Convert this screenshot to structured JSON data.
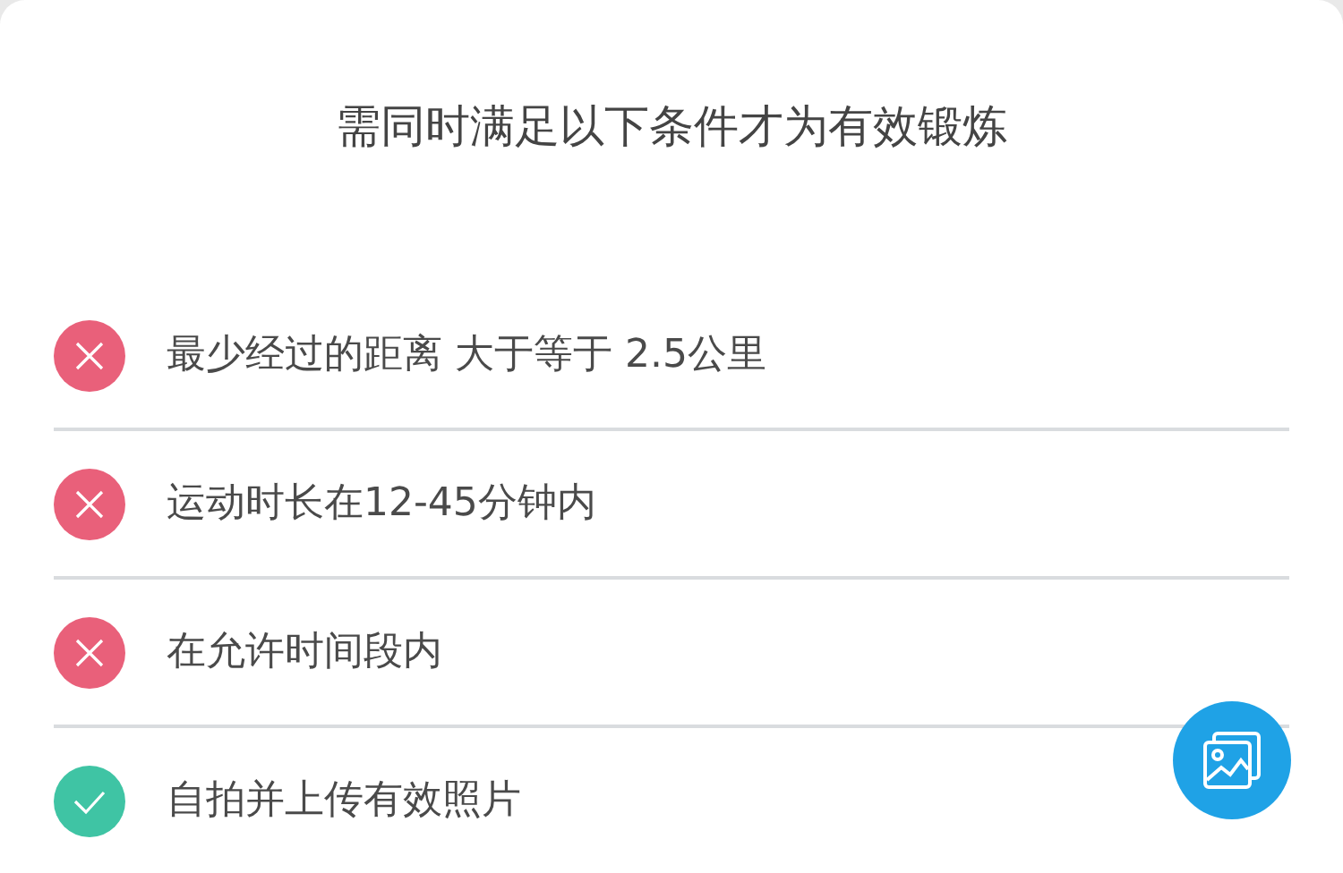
{
  "dialog": {
    "title": "需同时满足以下条件才为有效锻炼"
  },
  "conditions": [
    {
      "text": "最少经过的距离 大于等于 2.5公里",
      "checked": false
    },
    {
      "text": "运动时长在12-45分钟内",
      "checked": false
    },
    {
      "text": "在允许时间段内",
      "checked": false
    },
    {
      "text": "自拍并上传有效照片",
      "checked": true
    }
  ]
}
